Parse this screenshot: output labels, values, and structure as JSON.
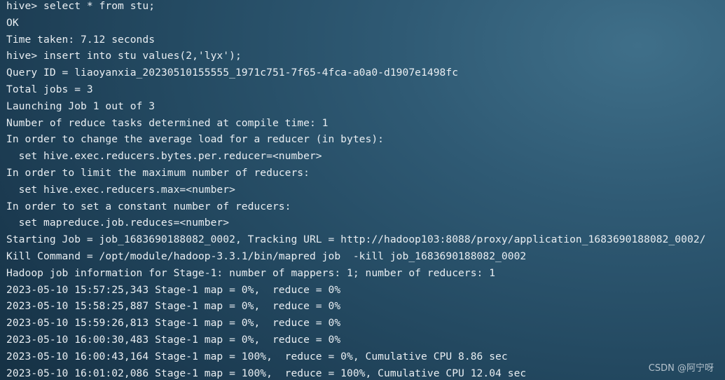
{
  "terminal": {
    "lines": [
      "hive> select * from stu;",
      "OK",
      "Time taken: 7.12 seconds",
      "hive> insert into stu values(2,'lyx');",
      "Query ID = liaoyanxia_20230510155555_1971c751-7f65-4fca-a0a0-d1907e1498fc",
      "Total jobs = 3",
      "Launching Job 1 out of 3",
      "Number of reduce tasks determined at compile time: 1",
      "In order to change the average load for a reducer (in bytes):",
      "  set hive.exec.reducers.bytes.per.reducer=<number>",
      "In order to limit the maximum number of reducers:",
      "  set hive.exec.reducers.max=<number>",
      "In order to set a constant number of reducers:",
      "  set mapreduce.job.reduces=<number>",
      "Starting Job = job_1683690188082_0002, Tracking URL = http://hadoop103:8088/proxy/application_1683690188082_0002/",
      "Kill Command = /opt/module/hadoop-3.3.1/bin/mapred job  -kill job_1683690188082_0002",
      "Hadoop job information for Stage-1: number of mappers: 1; number of reducers: 1",
      "2023-05-10 15:57:25,343 Stage-1 map = 0%,  reduce = 0%",
      "2023-05-10 15:58:25,887 Stage-1 map = 0%,  reduce = 0%",
      "2023-05-10 15:59:26,813 Stage-1 map = 0%,  reduce = 0%",
      "2023-05-10 16:00:30,483 Stage-1 map = 0%,  reduce = 0%",
      "2023-05-10 16:00:43,164 Stage-1 map = 100%,  reduce = 0%, Cumulative CPU 8.86 sec",
      "2023-05-10 16:01:02,086 Stage-1 map = 100%,  reduce = 100%, Cumulative CPU 12.04 sec"
    ]
  },
  "watermark": {
    "text": "CSDN @阿宁呀"
  }
}
